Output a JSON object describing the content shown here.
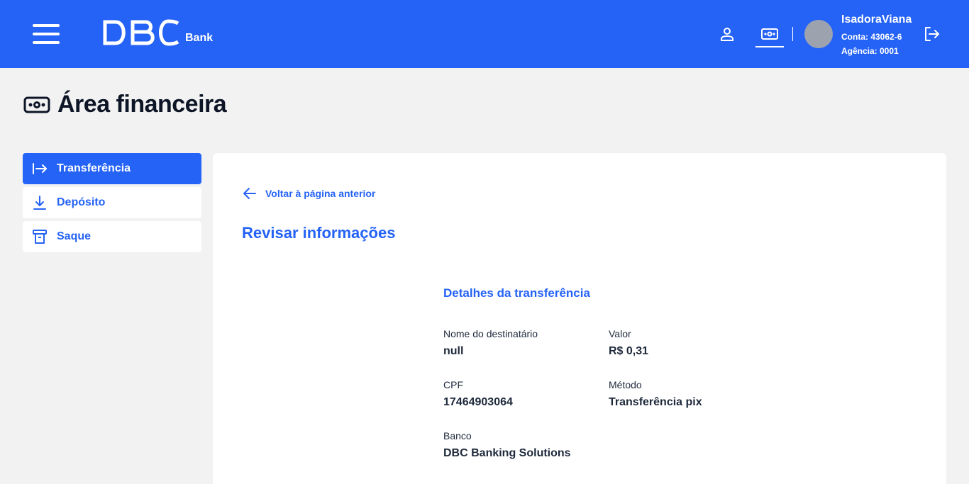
{
  "header": {
    "brand": {
      "logo_text": "DBC",
      "logo_suffix": "Bank"
    },
    "user": {
      "name": "IsadoraViana",
      "account": "Conta: 43062-6",
      "agency": "Agência: 0001"
    },
    "colors": {
      "primary": "#2563f6",
      "avatar": "#9ca3af"
    },
    "icons": [
      "menu-icon",
      "user-icon",
      "money-icon",
      "logout-icon"
    ]
  },
  "page": {
    "title": "Área financeira",
    "title_icon": "money-icon"
  },
  "sidebar": {
    "items": [
      {
        "label": "Transferência",
        "icon": "transfer-icon",
        "active": true
      },
      {
        "label": "Depósito",
        "icon": "download-icon",
        "active": false
      },
      {
        "label": "Saque",
        "icon": "atm-icon",
        "active": false
      }
    ]
  },
  "main": {
    "back_label": "Voltar à página anterior",
    "title": "Revisar informações",
    "details": {
      "title": "Detalhes da transferência",
      "fields": [
        {
          "label": "Nome do destinatário",
          "value": "null"
        },
        {
          "label": "Valor",
          "value": "R$ 0,31"
        },
        {
          "label": "CPF",
          "value": "17464903064"
        },
        {
          "label": "Método",
          "value": "Transferência pix"
        },
        {
          "label": "Banco",
          "value": "DBC Banking Solutions"
        }
      ]
    }
  }
}
